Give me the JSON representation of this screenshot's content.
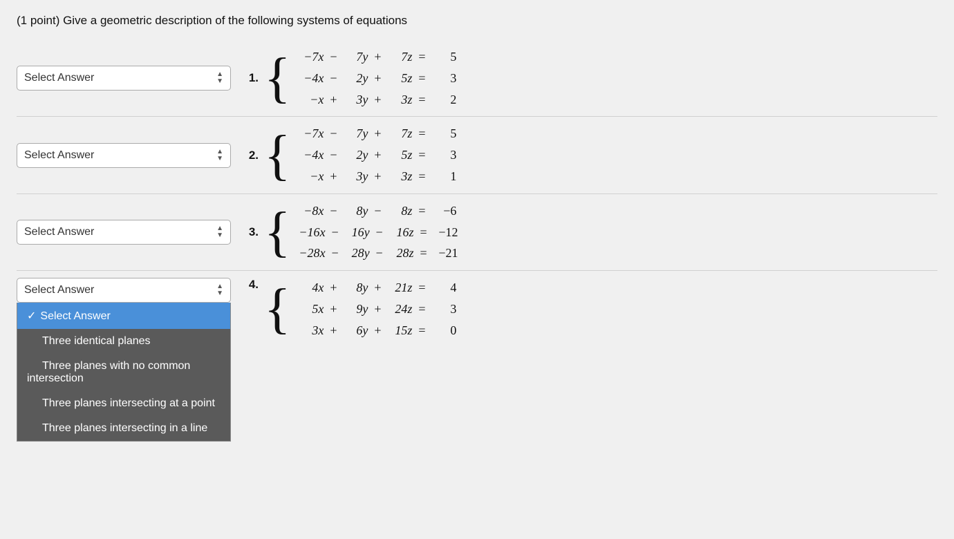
{
  "title": "(1 point) Give a geometric description of the following systems of equations",
  "problems": [
    {
      "number": "1.",
      "equations": [
        {
          "lhs": "−7x",
          "op1": "−",
          "term2": "7y",
          "op2": "+",
          "term3": "7z",
          "eq": "=",
          "rhs": "5"
        },
        {
          "lhs": "−4x",
          "op1": "−",
          "term2": "2y",
          "op2": "+",
          "term3": "5z",
          "eq": "=",
          "rhs": "3"
        },
        {
          "lhs": "−x",
          "op1": "+",
          "term2": "3y",
          "op2": "+",
          "term3": "3z",
          "eq": "=",
          "rhs": "2"
        }
      ]
    },
    {
      "number": "2.",
      "equations": [
        {
          "lhs": "−7x",
          "op1": "−",
          "term2": "7y",
          "op2": "+",
          "term3": "7z",
          "eq": "=",
          "rhs": "5"
        },
        {
          "lhs": "−4x",
          "op1": "−",
          "term2": "2y",
          "op2": "+",
          "term3": "5z",
          "eq": "=",
          "rhs": "3"
        },
        {
          "lhs": "−x",
          "op1": "+",
          "term2": "3y",
          "op2": "+",
          "term3": "3z",
          "eq": "=",
          "rhs": "1"
        }
      ]
    },
    {
      "number": "3.",
      "equations": [
        {
          "lhs": "−8x",
          "op1": "−",
          "term2": "8y",
          "op2": "−",
          "term3": "8z",
          "eq": "=",
          "rhs": "−6"
        },
        {
          "lhs": "−16x",
          "op1": "−",
          "term2": "16y",
          "op2": "−",
          "term3": "16z",
          "eq": "=",
          "rhs": "−12"
        },
        {
          "lhs": "−28x",
          "op1": "−",
          "term2": "28y",
          "op2": "−",
          "term3": "28z",
          "eq": "=",
          "rhs": "−21"
        }
      ]
    },
    {
      "number": "4.",
      "equations": [
        {
          "lhs": "4x",
          "op1": "+",
          "term2": "8y",
          "op2": "+",
          "term3": "21z",
          "eq": "=",
          "rhs": "4"
        },
        {
          "lhs": "5x",
          "op1": "+",
          "term2": "9y",
          "op2": "+",
          "term3": "24z",
          "eq": "=",
          "rhs": "3"
        },
        {
          "lhs": "3x",
          "op1": "+",
          "term2": "6y",
          "op2": "+",
          "term3": "15z",
          "eq": "=",
          "rhs": "0"
        }
      ]
    }
  ],
  "select_label": "Select Answer",
  "dropdown_options": [
    {
      "label": "Select Answer",
      "selected": true
    },
    {
      "label": "Three identical planes",
      "selected": false
    },
    {
      "label": "Three planes with no common intersection",
      "selected": false
    },
    {
      "label": "Three planes intersecting at a point",
      "selected": false
    },
    {
      "label": "Three planes intersecting in a line",
      "selected": false
    }
  ],
  "checkmark": "✓"
}
